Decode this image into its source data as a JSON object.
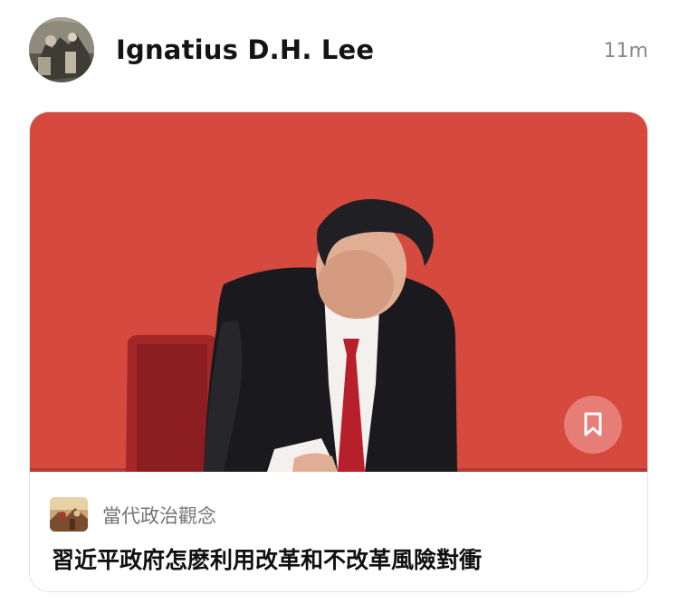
{
  "post": {
    "author_name": "Ignatius D.H. Lee",
    "timestamp": "11m"
  },
  "card": {
    "image_background": "#d5493e",
    "bookmark_icon": "bookmark-icon",
    "publication_name": "當代政治觀念",
    "article_title": "習近平政府怎麽利用改革和不改革風險對衝"
  }
}
